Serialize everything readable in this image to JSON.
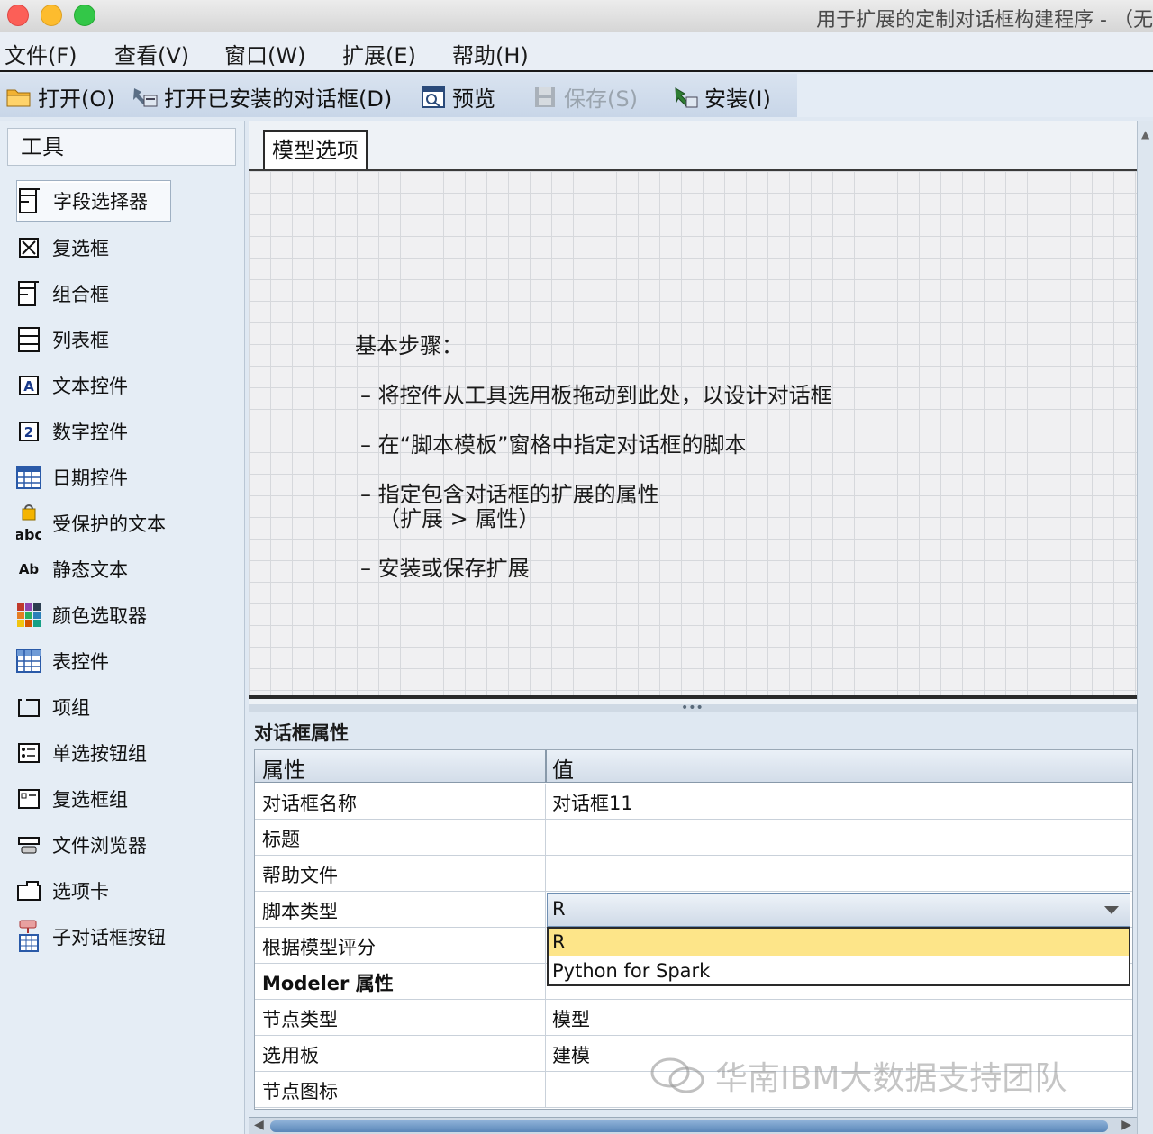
{
  "window": {
    "title": "用于扩展的定制对话框构建程序 - （无"
  },
  "menu": [
    "文件(F)",
    "查看(V)",
    "窗口(W)",
    "扩展(E)",
    "帮助(H)"
  ],
  "toolbar": {
    "open": "打开(O)",
    "open_installed": "打开已安装的对话框(D)",
    "preview": "预览",
    "save": "保存(S)",
    "install": "安装(I)"
  },
  "palette": {
    "title": "工具",
    "tools": [
      {
        "label": "字段选择器",
        "icon": "field-chooser-icon"
      },
      {
        "label": "复选框",
        "icon": "checkbox-icon"
      },
      {
        "label": "组合框",
        "icon": "combo-box-icon"
      },
      {
        "label": "列表框",
        "icon": "list-box-icon"
      },
      {
        "label": "文本控件",
        "icon": "text-control-icon"
      },
      {
        "label": "数字控件",
        "icon": "number-control-icon"
      },
      {
        "label": "日期控件",
        "icon": "date-control-icon"
      },
      {
        "label": "受保护的文本",
        "icon": "secured-text-icon"
      },
      {
        "label": "静态文本",
        "icon": "static-text-icon"
      },
      {
        "label": "颜色选取器",
        "icon": "color-picker-icon"
      },
      {
        "label": "表控件",
        "icon": "table-control-icon"
      },
      {
        "label": "项组",
        "icon": "item-group-icon"
      },
      {
        "label": "单选按钮组",
        "icon": "radio-group-icon"
      },
      {
        "label": "复选框组",
        "icon": "checkbox-group-icon"
      },
      {
        "label": "文件浏览器",
        "icon": "file-browser-icon"
      },
      {
        "label": "选项卡",
        "icon": "tab-icon"
      },
      {
        "label": "子对话框按钮",
        "icon": "subdialog-button-icon"
      }
    ]
  },
  "canvas": {
    "tab": "模型选项",
    "instructions": {
      "heading": "基本步骤：",
      "step1": "– 将控件从工具选用板拖动到此处，以设计对话框",
      "step2": "– 在“脚本模板”窗格中指定对话框的脚本",
      "step3": "– 指定包含对话框的扩展的属性",
      "step3b": "（扩展 > 属性）",
      "step4": "– 安装或保存扩展"
    }
  },
  "properties": {
    "title": "对话框属性",
    "col_property": "属性",
    "col_value": "值",
    "rows": [
      {
        "key": "对话框名称",
        "value": "对话框11"
      },
      {
        "key": "标题",
        "value": ""
      },
      {
        "key": "帮助文件",
        "value": ""
      },
      {
        "key": "脚本类型",
        "value": "R"
      },
      {
        "key": "根据模型评分",
        "value": ""
      },
      {
        "key": "Modeler 属性",
        "value": ""
      },
      {
        "key": "节点类型",
        "value": "模型"
      },
      {
        "key": "选用板",
        "value": "建模"
      },
      {
        "key": "节点图标",
        "value": ""
      }
    ],
    "dropdown_options": [
      "R",
      "Python for Spark"
    ]
  },
  "watermark": "华南IBM大数据支持团队"
}
